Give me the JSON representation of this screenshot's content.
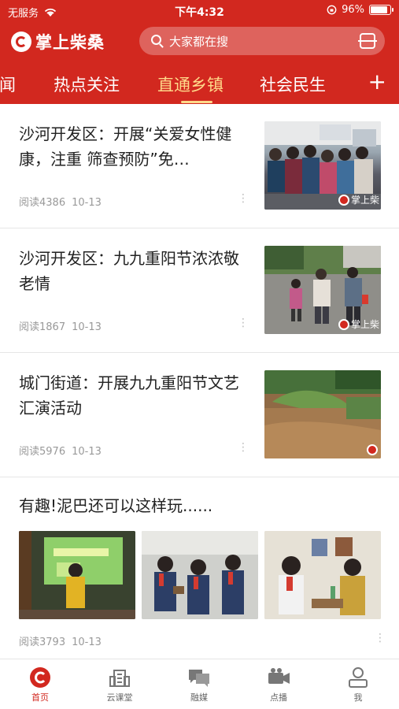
{
  "status_bar": {
    "carrier": "无服务",
    "time": "下午4:32",
    "battery": "96%"
  },
  "app": {
    "name": "掌上柴桑",
    "search_placeholder": "大家都在搜"
  },
  "tabs": [
    {
      "label": "要闻",
      "active": false
    },
    {
      "label": "热点关注",
      "active": false
    },
    {
      "label": "直通乡镇",
      "active": true
    },
    {
      "label": "社会民生",
      "active": false
    }
  ],
  "articles": [
    {
      "title": "沙河开发区：开展“关爱女性健康，注重  筛查预防”免…",
      "reads": "阅读4386",
      "date": "10-13",
      "watermark": "掌上柴"
    },
    {
      "title": "沙河开发区：九九重阳节浓浓敬老情",
      "reads": "阅读1867",
      "date": "10-13",
      "watermark": "掌上柴"
    },
    {
      "title": "城门街道：开展九九重阳节文艺汇演活动",
      "reads": "阅读5976",
      "date": "10-13",
      "watermark": ""
    },
    {
      "title": "有趣!泥巴还可以这样玩......",
      "reads": "阅读3793",
      "date": "10-13"
    }
  ],
  "bottom_nav": [
    {
      "label": "首页",
      "icon": "home-logo-icon",
      "active": true
    },
    {
      "label": "云课堂",
      "icon": "building-icon",
      "active": false
    },
    {
      "label": "融媒",
      "icon": "chat-bubbles-icon",
      "active": false
    },
    {
      "label": "点播",
      "icon": "video-camera-icon",
      "active": false
    },
    {
      "label": "我",
      "icon": "person-icon",
      "active": false
    }
  ],
  "colors": {
    "brand_red": "#d2281f",
    "active_tab": "#ffd98a"
  }
}
